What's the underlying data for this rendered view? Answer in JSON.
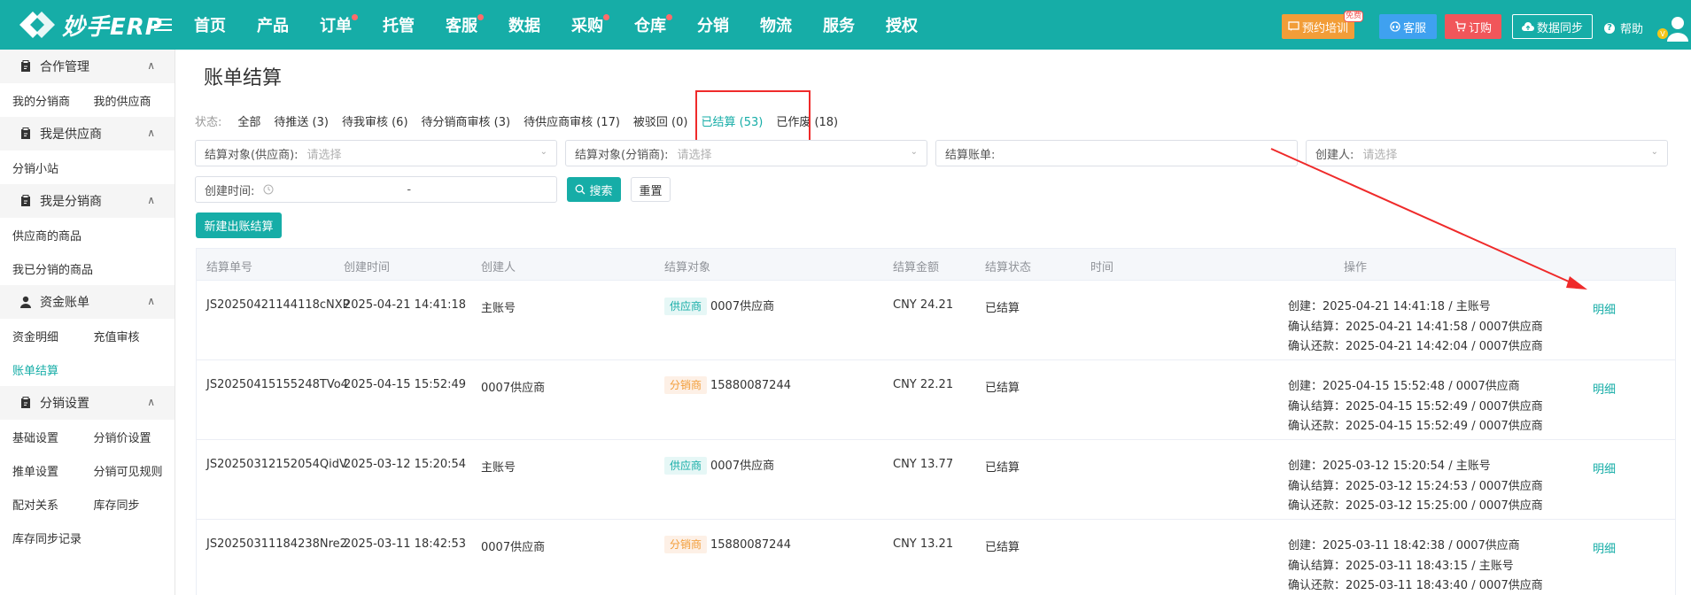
{
  "app": {
    "logo_text": "妙手ERP"
  },
  "nav": [
    {
      "label": "首页",
      "dot": false
    },
    {
      "label": "产品",
      "dot": false
    },
    {
      "label": "订单",
      "dot": true
    },
    {
      "label": "托管",
      "dot": false
    },
    {
      "label": "客服",
      "dot": true
    },
    {
      "label": "数据",
      "dot": false
    },
    {
      "label": "采购",
      "dot": true
    },
    {
      "label": "仓库",
      "dot": true
    },
    {
      "label": "分销",
      "dot": false
    },
    {
      "label": "物流",
      "dot": false
    },
    {
      "label": "服务",
      "dot": false
    },
    {
      "label": "授权",
      "dot": false
    }
  ],
  "topright": {
    "training": "预约培训",
    "free_badge": "免费",
    "kefu": "客服",
    "order": "订购",
    "sync": "数据同步",
    "help": "帮助"
  },
  "sidebar": {
    "groups": [
      {
        "title": "合作管理",
        "icon": "clipboard-icon",
        "rows": [
          [
            "我的分销商",
            "我的供应商"
          ]
        ]
      },
      {
        "title": "我是供应商",
        "icon": "clipboard-icon",
        "rows": [
          [
            "分销小站"
          ]
        ]
      },
      {
        "title": "我是分销商",
        "icon": "clipboard-icon",
        "rows": [
          [
            "供应商的商品"
          ],
          [
            "我已分销的商品"
          ]
        ]
      },
      {
        "title": "资金账单",
        "icon": "user-icon",
        "rows": [
          [
            "资金明细",
            "充值审核"
          ],
          [
            "账单结算"
          ]
        ]
      },
      {
        "title": "分销设置",
        "icon": "clipboard-icon",
        "rows": [
          [
            "基础设置",
            "分销价设置"
          ],
          [
            "推单设置",
            "分销可见规则"
          ],
          [
            "配对关系",
            "库存同步"
          ],
          [
            "库存同步记录"
          ]
        ]
      }
    ],
    "active": "账单结算"
  },
  "page": {
    "title": "账单结算"
  },
  "status": {
    "label": "状态:",
    "items": [
      {
        "label": "全部",
        "active": false
      },
      {
        "label": "待推送 (3)",
        "active": false
      },
      {
        "label": "待我审核 (6)",
        "active": false
      },
      {
        "label": "待分销商审核 (3)",
        "active": false
      },
      {
        "label": "待供应商审核 (17)",
        "active": false
      },
      {
        "label": "被驳回 (0)",
        "active": false
      },
      {
        "label": "已结算 (53)",
        "active": true
      },
      {
        "label": "已作废 (18)",
        "active": false
      }
    ]
  },
  "filters": {
    "supplier_label": "结算对象(供应商):",
    "supplier_placeholder": "请选择",
    "distributor_label": "结算对象(分销商):",
    "distributor_placeholder": "请选择",
    "bill_label": "结算账单:",
    "bill_value": "",
    "creator_label": "创建人:",
    "creator_placeholder": "请选择",
    "created_time_label": "创建时间:",
    "range_sep": "-"
  },
  "buttons": {
    "search": "搜索",
    "reset": "重置",
    "new": "新建出账结算"
  },
  "table": {
    "headers": [
      "结算单号",
      "创建时间",
      "创建人",
      "结算对象",
      "结算金额",
      "结算状态",
      "时间",
      "操作"
    ],
    "rows": [
      {
        "no": "JS20250421144118cNXP",
        "created": "2025-04-21 14:41:18",
        "creator": "主账号",
        "target_tag": "供应商",
        "target_type": "sup",
        "target_name": "0007供应商",
        "amount": "CNY 24.21",
        "status": "已结算",
        "t1": "创建：2025-04-21 14:41:18 / 主账号",
        "t2": "确认结算：2025-04-21 14:41:58 / 0007供应商",
        "t3": "确认还款：2025-04-21 14:42:04 / 0007供应商",
        "action": "明细"
      },
      {
        "no": "JS20250415155248TVo4",
        "created": "2025-04-15 15:52:49",
        "creator": "0007供应商",
        "target_tag": "分销商",
        "target_type": "dis",
        "target_name": "15880087244",
        "amount": "CNY 22.21",
        "status": "已结算",
        "t1": "创建：2025-04-15 15:52:48 / 0007供应商",
        "t2": "确认结算：2025-04-15 15:52:49 / 0007供应商",
        "t3": "确认还款：2025-04-15 15:52:49 / 0007供应商",
        "action": "明细"
      },
      {
        "no": "JS20250312152054QidV",
        "created": "2025-03-12 15:20:54",
        "creator": "主账号",
        "target_tag": "供应商",
        "target_type": "sup",
        "target_name": "0007供应商",
        "amount": "CNY 13.77",
        "status": "已结算",
        "t1": "创建：2025-03-12 15:20:54 / 主账号",
        "t2": "确认结算：2025-03-12 15:24:53 / 0007供应商",
        "t3": "确认还款：2025-03-12 15:25:00 / 0007供应商",
        "action": "明细"
      },
      {
        "no": "JS20250311184238Nre2",
        "created": "2025-03-11 18:42:53",
        "creator": "0007供应商",
        "target_tag": "分销商",
        "target_type": "dis",
        "target_name": "15880087244",
        "amount": "CNY 13.21",
        "status": "已结算",
        "t1": "创建：2025-03-11 18:42:38 / 0007供应商",
        "t2": "确认结算：2025-03-11 18:43:15 / 主账号",
        "t3": "确认还款：2025-03-11 18:43:40 / 0007供应商",
        "action": "明细"
      }
    ]
  },
  "colors": {
    "brand": "#16ada7",
    "annotation": "#ef2a2a"
  }
}
